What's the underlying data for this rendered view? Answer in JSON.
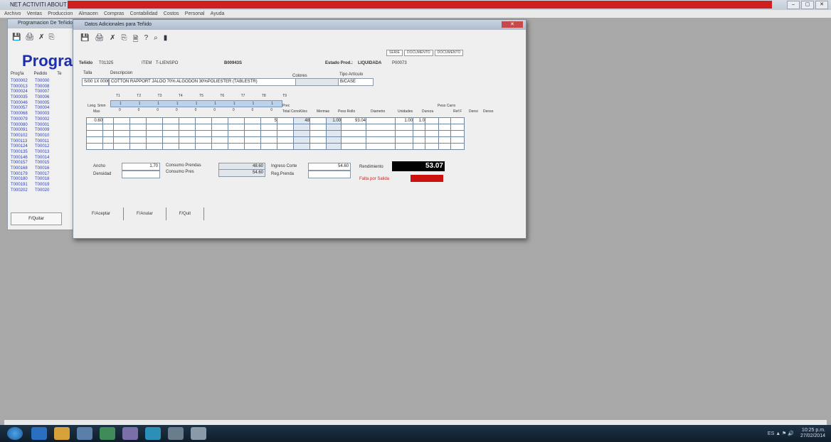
{
  "app": {
    "title": "NET ACTIVITI ABOUT",
    "controls": [
      "–",
      "▢",
      "✕"
    ]
  },
  "menu": [
    "Archivo",
    "Ventas",
    "Produccion",
    "Almacen",
    "Compras",
    "Contabilidad",
    "Costos",
    "Personal",
    "Ayuda"
  ],
  "bg_window": {
    "title": "Programacion De Teñido",
    "heading": "Progra",
    "columns": [
      "Prog'la",
      "Pedido",
      "Te"
    ],
    "rows": [
      [
        "T000002",
        "T00000"
      ],
      [
        "T000013",
        "T00008"
      ],
      [
        "T000024",
        "T00007"
      ],
      [
        "T000035",
        "T00006"
      ],
      [
        "T000046",
        "T00005"
      ],
      [
        "T000057",
        "T00004"
      ],
      [
        "T000068",
        "T00003"
      ],
      [
        "T000079",
        "T00002"
      ],
      [
        "T000080",
        "T00001"
      ],
      [
        "T000091",
        "T00009"
      ],
      [
        "T000102",
        "T00010"
      ],
      [
        "T000113",
        "T00011"
      ],
      [
        "T000124",
        "T00012"
      ],
      [
        "T000135",
        "T00013"
      ],
      [
        "T000146",
        "T00014"
      ],
      [
        "T000157",
        "T00015"
      ],
      [
        "T000168",
        "T00016"
      ],
      [
        "T000179",
        "T00017"
      ],
      [
        "T000180",
        "T00018"
      ],
      [
        "T000191",
        "T00019"
      ],
      [
        "T000202",
        "T00020"
      ]
    ],
    "button": "F/Quitar"
  },
  "win": {
    "title": "Datos Adicionales para Teñido",
    "close": "✕",
    "toolbar": [
      "💾",
      "🖨",
      "✗",
      "⎘",
      "🗎",
      "?",
      "⌕",
      "▮"
    ],
    "date_boxes": [
      "SERIE",
      "DOCUMENTO",
      "DOCUMENTO"
    ],
    "tenido_label": "Teñido",
    "tenido_value": "T01325",
    "item_label": "ITEM",
    "item_value": "T-LIENSPO",
    "code": "B00943S",
    "estado_label": "Estado Prod.:",
    "estado_value": "LIQUIDADA",
    "estado_code": "P00073",
    "talla_label": "Talla",
    "descripcion_label": "Descripcion",
    "colores_label": "Colores",
    "tipo_label": "Tipo Artículo",
    "talla_value": "S/00 1X 0000",
    "descripcion_value": "COTTON RAPPORT JALOO 70% ALGODON 30%POLIESTER (TABLESTR)",
    "colores_value": "",
    "tipo_value": "B/CASE",
    "size_labels": [
      "T1",
      "T2",
      "T3",
      "T4",
      "T5",
      "T6",
      "T7",
      "T8",
      "T9"
    ],
    "size_row1": [
      "1",
      "1",
      "1",
      "1",
      "1",
      "1",
      "1",
      "1",
      "1"
    ],
    "col_headers": [
      "Long. Smm",
      "Max",
      "Prec",
      "Total Cono",
      "Kilos",
      "Mermas",
      "Peso Rollo",
      "Diametro",
      "Unidades",
      "Dureza",
      "Peso Carro",
      "Ref F",
      "Densi",
      "Denso"
    ],
    "size_row2": [
      "0",
      "0",
      "0",
      "0",
      "0",
      "0",
      "0",
      "0",
      "0"
    ],
    "grid_row1": [
      "0.60",
      "",
      "",
      "",
      "",
      "",
      "",
      "",
      "",
      "",
      "",
      "5",
      "",
      "48",
      "",
      "1.00",
      "93.04",
      "",
      "1.00",
      "1.0",
      "",
      "",
      ""
    ],
    "ancho_label": "Ancho",
    "ancho_value": "1.70",
    "densidad_label": "Densidad",
    "densidad_value": "",
    "consumo_prenda_label": "Consumo Prendas",
    "consumo_prenda_value": "48.60",
    "consumo_pres_label": "Consumo Pres",
    "consumo_pres_value": "54.60",
    "ingreso_label": "Ingreso Corte",
    "ingreso_value": "54.60",
    "reg_prenda_label": "Reg.Prenda",
    "reg_prenda_value": "",
    "rendimiento_label": "Rendimiento",
    "rendimiento_value": "53.07",
    "falta_label": "Falta por Salida",
    "falta_value": "",
    "buttons": [
      "F/Aceptar",
      "F/Anular",
      "F/Quit"
    ]
  },
  "taskbar": {
    "clock_time": "10:25 p.m.",
    "clock_date": "27/02/2014",
    "tray": "ES ▲ ⚑ 🔊"
  },
  "colors": {
    "accent_blue": "#1c2fb0",
    "title_red": "#cf1f1f",
    "rend_bg": "#000000",
    "falta_bg": "#cc1111"
  }
}
